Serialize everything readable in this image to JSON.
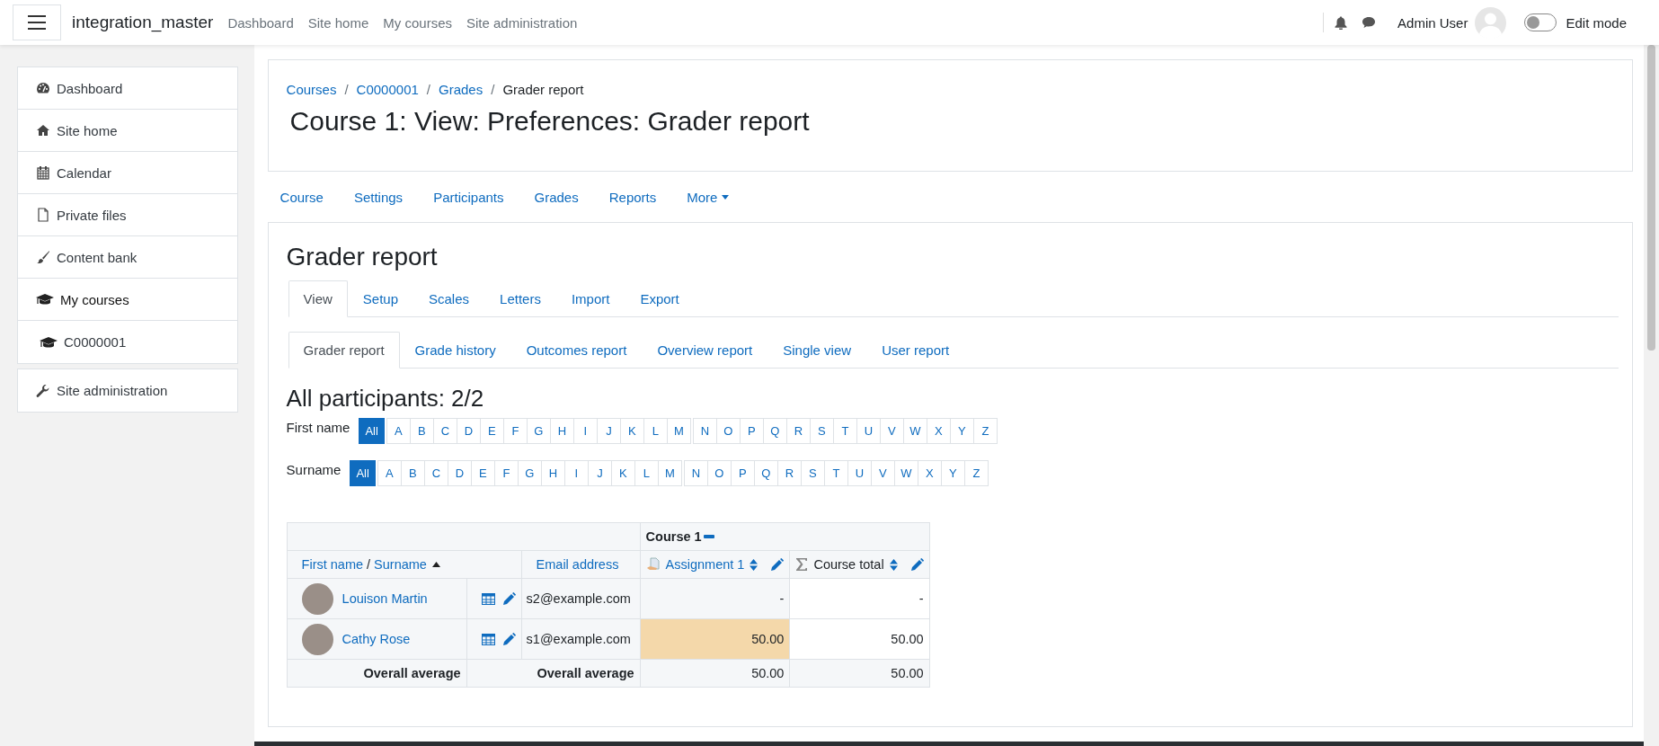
{
  "navbar": {
    "site_name": "integration_master",
    "links": [
      "Dashboard",
      "Site home",
      "My courses",
      "Site administration"
    ],
    "user_name": "Admin User",
    "edit_mode": {
      "label": "Edit mode",
      "on": false
    }
  },
  "sidebar": {
    "items": [
      {
        "label": "Dashboard"
      },
      {
        "label": "Site home"
      },
      {
        "label": "Calendar"
      },
      {
        "label": "Private files"
      },
      {
        "label": "Content bank"
      },
      {
        "label": "My courses",
        "children": [
          {
            "label": "C0000001"
          }
        ]
      }
    ],
    "admin": {
      "label": "Site administration"
    }
  },
  "breadcrumb": [
    {
      "label": "Courses",
      "separator": "/"
    },
    {
      "label": "C0000001",
      "separator": "/"
    },
    {
      "label": "Grades",
      "separator": "/"
    },
    {
      "label": "Grader report"
    }
  ],
  "page_title": "Course 1: View: Preferences: Grader report",
  "course_nav": [
    {
      "label": "Course",
      "dropdown": false
    },
    {
      "label": "Settings",
      "dropdown": false
    },
    {
      "label": "Participants",
      "dropdown": false
    },
    {
      "label": "Grades",
      "dropdown": false
    },
    {
      "label": "Reports",
      "dropdown": false
    },
    {
      "label": "More",
      "dropdown": true
    }
  ],
  "report_heading": "Grader report",
  "tabs": [
    {
      "label": "View",
      "selected": true
    },
    {
      "label": "Setup",
      "selected": false
    },
    {
      "label": "Scales",
      "selected": false
    },
    {
      "label": "Letters",
      "selected": false
    },
    {
      "label": "Import",
      "selected": false
    },
    {
      "label": "Export",
      "selected": false
    }
  ],
  "subtabs": [
    {
      "label": "Grader report",
      "selected": true
    },
    {
      "label": "Grade history",
      "selected": false
    },
    {
      "label": "Outcomes report",
      "selected": false
    },
    {
      "label": "Overview report",
      "selected": false
    },
    {
      "label": "Single view",
      "selected": false
    },
    {
      "label": "User report",
      "selected": false
    }
  ],
  "participants_heading": "All participants: 2/2",
  "filters": [
    {
      "label": "First name",
      "groups": [
        [
          {
            "text": "All",
            "selected": true
          }
        ],
        [
          {
            "text": "A",
            "selected": false
          },
          {
            "text": "B",
            "selected": false
          },
          {
            "text": "C",
            "selected": false
          },
          {
            "text": "D",
            "selected": false
          },
          {
            "text": "E",
            "selected": false
          },
          {
            "text": "F",
            "selected": false
          },
          {
            "text": "G",
            "selected": false
          },
          {
            "text": "H",
            "selected": false
          },
          {
            "text": "I",
            "selected": false
          },
          {
            "text": "J",
            "selected": false
          },
          {
            "text": "K",
            "selected": false
          },
          {
            "text": "L",
            "selected": false
          },
          {
            "text": "M",
            "selected": false
          }
        ],
        [
          {
            "text": "N",
            "selected": false
          },
          {
            "text": "O",
            "selected": false
          },
          {
            "text": "P",
            "selected": false
          },
          {
            "text": "Q",
            "selected": false
          },
          {
            "text": "R",
            "selected": false
          },
          {
            "text": "S",
            "selected": false
          },
          {
            "text": "T",
            "selected": false
          },
          {
            "text": "U",
            "selected": false
          },
          {
            "text": "V",
            "selected": false
          },
          {
            "text": "W",
            "selected": false
          },
          {
            "text": "X",
            "selected": false
          },
          {
            "text": "Y",
            "selected": false
          },
          {
            "text": "Z",
            "selected": false
          }
        ]
      ]
    },
    {
      "label": "Surname",
      "groups": [
        [
          {
            "text": "All",
            "selected": true
          }
        ],
        [
          {
            "text": "A",
            "selected": false
          },
          {
            "text": "B",
            "selected": false
          },
          {
            "text": "C",
            "selected": false
          },
          {
            "text": "D",
            "selected": false
          },
          {
            "text": "E",
            "selected": false
          },
          {
            "text": "F",
            "selected": false
          },
          {
            "text": "G",
            "selected": false
          },
          {
            "text": "H",
            "selected": false
          },
          {
            "text": "I",
            "selected": false
          },
          {
            "text": "J",
            "selected": false
          },
          {
            "text": "K",
            "selected": false
          },
          {
            "text": "L",
            "selected": false
          },
          {
            "text": "M",
            "selected": false
          }
        ],
        [
          {
            "text": "N",
            "selected": false
          },
          {
            "text": "O",
            "selected": false
          },
          {
            "text": "P",
            "selected": false
          },
          {
            "text": "Q",
            "selected": false
          },
          {
            "text": "R",
            "selected": false
          },
          {
            "text": "S",
            "selected": false
          },
          {
            "text": "T",
            "selected": false
          },
          {
            "text": "U",
            "selected": false
          },
          {
            "text": "V",
            "selected": false
          },
          {
            "text": "W",
            "selected": false
          },
          {
            "text": "X",
            "selected": false
          },
          {
            "text": "Y",
            "selected": false
          },
          {
            "text": "Z",
            "selected": false
          }
        ]
      ]
    }
  ],
  "table": {
    "category": "Course 1",
    "name_sort": {
      "first": "First name",
      "separator": "/",
      "last": "Surname"
    },
    "email_header": "Email address",
    "assignment_header": "Assignment 1",
    "total_header": "Course total",
    "rows": [
      {
        "name": "Louison Martin",
        "email": "s2@example.com",
        "assignment": "-",
        "total": "-",
        "overridden": false
      },
      {
        "name": "Cathy Rose",
        "email": "s1@example.com",
        "assignment": "50.00",
        "total": "50.00",
        "overridden": true
      }
    ],
    "averages": {
      "label_1": "Overall average",
      "label_2": "Overall average",
      "assignment": "50.00",
      "total": "50.00"
    }
  }
}
